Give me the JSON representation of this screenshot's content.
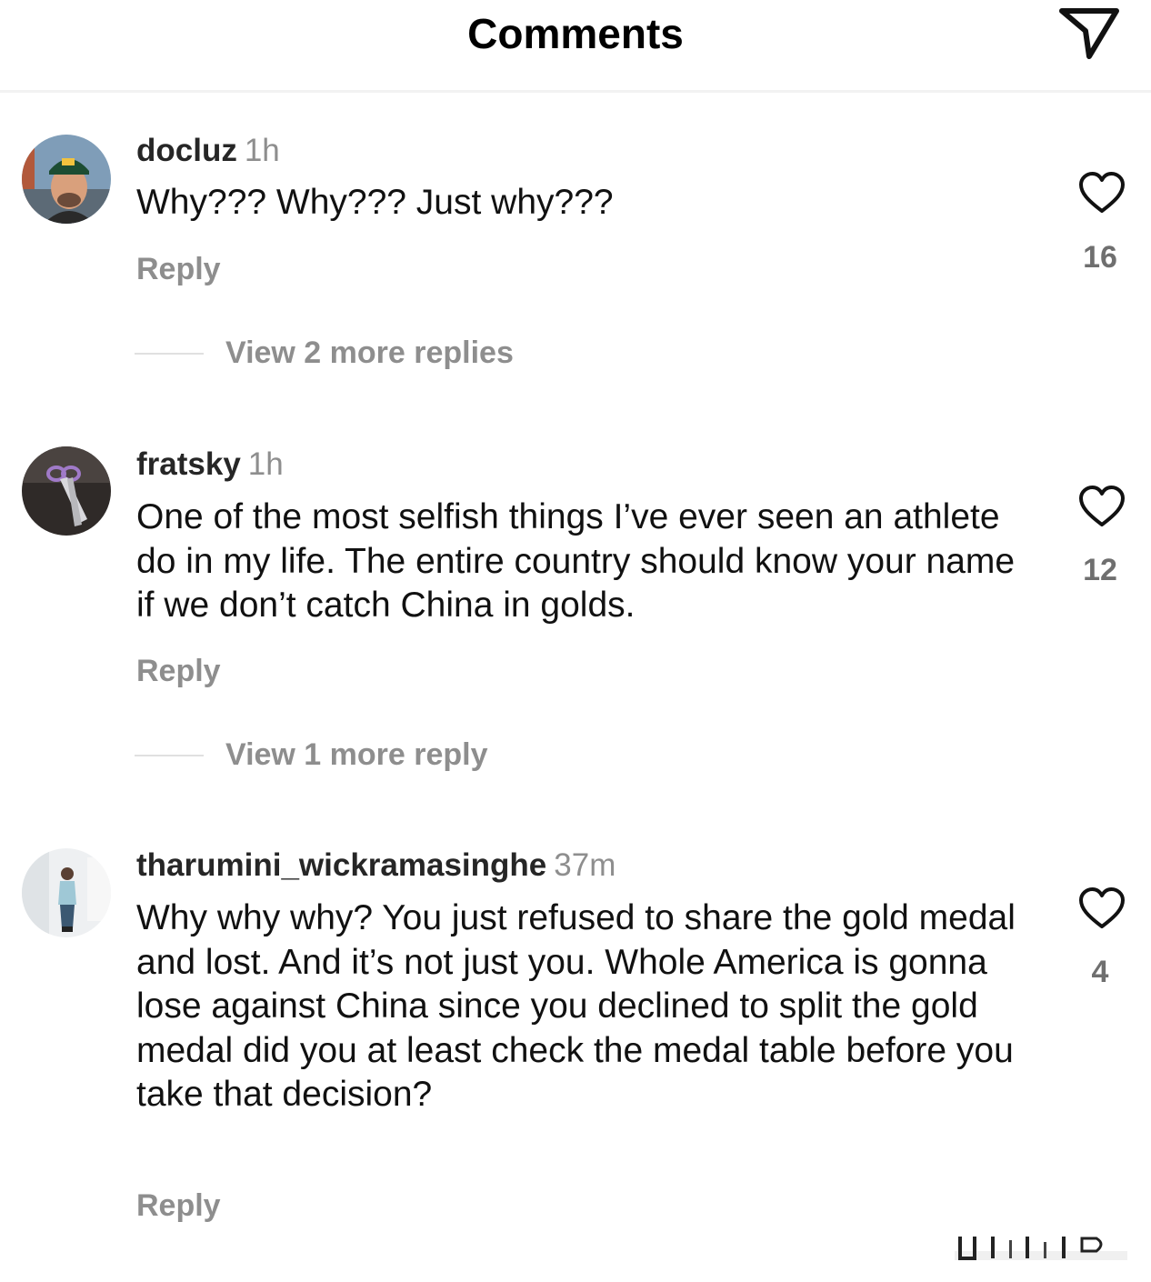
{
  "header": {
    "title": "Comments",
    "share_icon": "send-icon"
  },
  "comments": [
    {
      "username": "docluz",
      "time": "1h",
      "text": "Why??? Why??? Just why???",
      "reply_label": "Reply",
      "likes": "16",
      "view_replies": "View 2 more replies"
    },
    {
      "username": "fratsky",
      "time": "1h",
      "text": "One of the most selfish things I’ve ever seen an athlete do in my life. The entire country should know your name if we don’t catch China in golds.",
      "reply_label": "Reply",
      "likes": "12",
      "view_replies": "View 1 more reply"
    },
    {
      "username": "tharumini_wickramasinghe",
      "time": "37m",
      "text": "Why why why? You just refused to share the gold medal and lost. And it’s not just you. Whole America is gonna lose against China since you declined to split the gold medal did you at least check the medal table before you take that decision?",
      "reply_label": "Reply",
      "likes": "4"
    }
  ],
  "icons": {
    "like": "heart-outline-icon",
    "share": "send-icon"
  }
}
